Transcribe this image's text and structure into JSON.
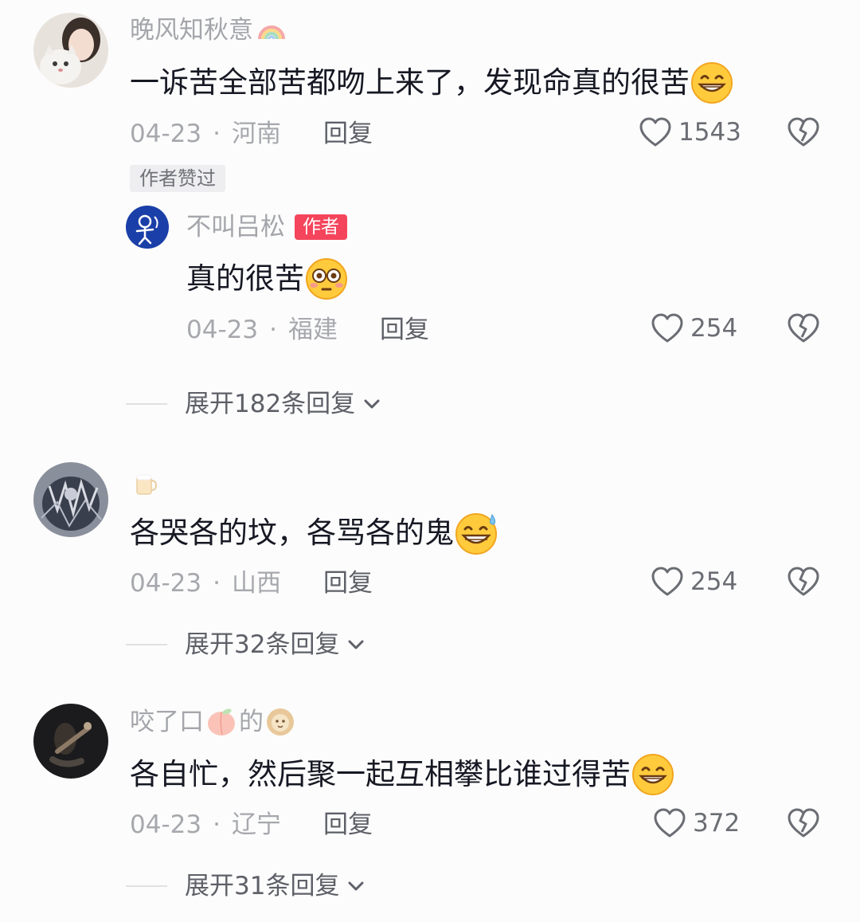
{
  "comments": [
    {
      "username": "晚风知秋意",
      "username_suffix_icon": "rainbow-icon",
      "text": "一诉苦全部苦都吻上来了，发现命真的很苦",
      "text_emoji": "grin-emoji",
      "date": "04-23",
      "location": "河南",
      "reply_label": "回复",
      "likes": "1543",
      "liked_badge": "作者赞过",
      "replies": [
        {
          "username": "不叫吕松",
          "author_tag": "作者",
          "text": "真的很苦",
          "text_emoji": "flushed-emoji",
          "date": "04-23",
          "location": "福建",
          "reply_label": "回复",
          "likes": "254"
        }
      ],
      "expand_label": "展开182条回复"
    },
    {
      "username": "",
      "username_icon": "beer-icon",
      "text": "各哭各的坟，各骂各的鬼",
      "text_emoji": "grin-sweat-emoji",
      "date": "04-23",
      "location": "山西",
      "reply_label": "回复",
      "likes": "254",
      "expand_label": "展开32条回复"
    },
    {
      "username_part1": "咬了口",
      "username_part2": "的",
      "username_icons": [
        "peach-icon",
        "lion-icon"
      ],
      "text": "各自忙，然后聚一起互相攀比谁过得苦",
      "text_emoji": "grin-emoji",
      "date": "04-23",
      "location": "辽宁",
      "reply_label": "回复",
      "likes": "372",
      "expand_label": "展开31条回复"
    }
  ],
  "separator": "·",
  "colors": {
    "background": "#fcfcfc",
    "primary_text": "#161823",
    "secondary_text": "#a6a8ad",
    "author_tag": "#f4455c"
  }
}
